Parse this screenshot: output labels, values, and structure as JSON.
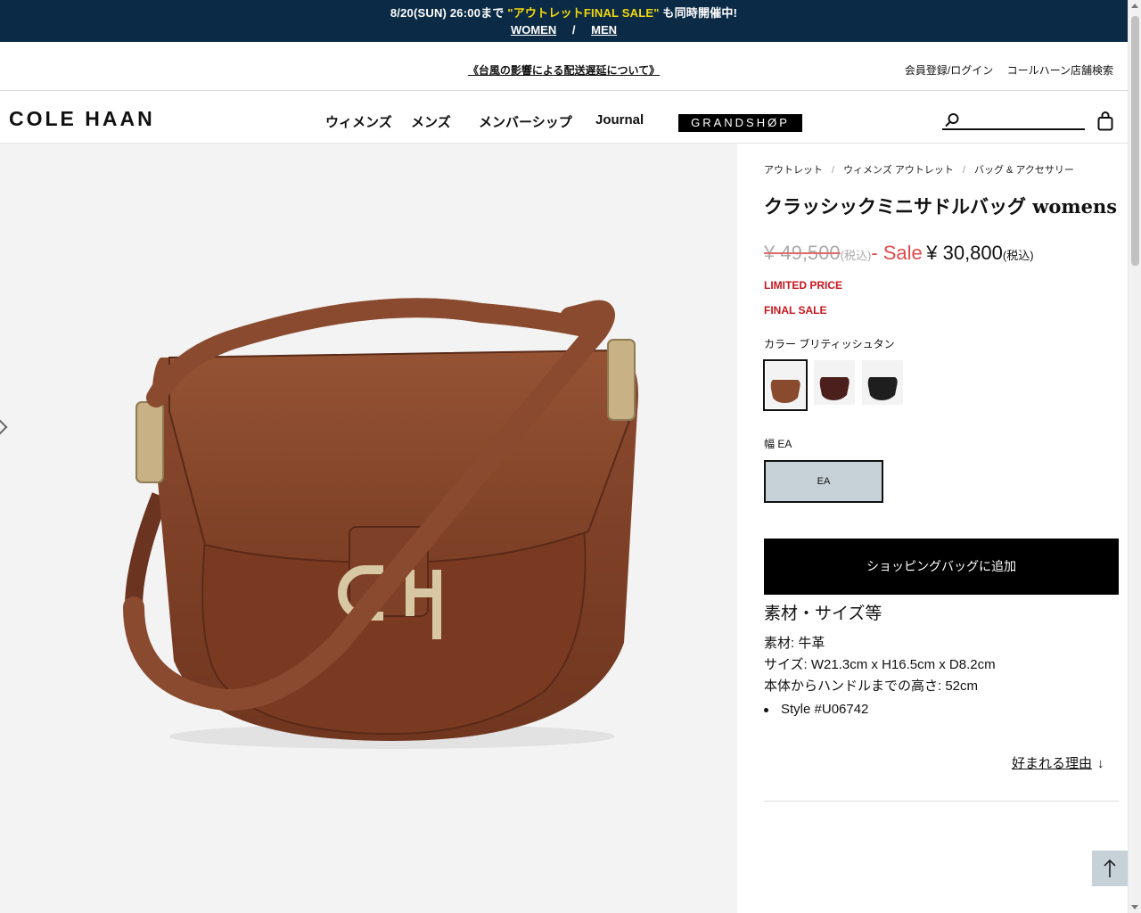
{
  "promo": {
    "text_prefix": "8/20(SUN) 26:00まで",
    "text_highlight": "\"アウトレットFINAL SALE\"",
    "text_suffix": "も同時開催中!",
    "link_women": "WOMEN",
    "separator": "/",
    "link_men": "MEN"
  },
  "util": {
    "notice": "《台風の影響による配送遅延について》",
    "login": "会員登録/ログイン",
    "store_search": "コールハーン店舗検索"
  },
  "header": {
    "logo": "COLE HAAN",
    "nav": {
      "women": "ウィメンズ",
      "men": "メンズ",
      "membership": "メンバーシップ",
      "journal": "Journal",
      "grandshop": "GRANDSHØP"
    },
    "search_placeholder": ""
  },
  "breadcrumb": [
    "アウトレット",
    "ウィメンズ アウトレット",
    "バッグ & アクセサリー"
  ],
  "breadcrumb_sep": "/",
  "product": {
    "title": "クラッシックミニサドルバッグ womens",
    "price_old": "¥ 49,500",
    "tax_old": "(税込)",
    "sale_label": "- Sale",
    "price_new": "¥ 30,800",
    "tax_new": "(税込)",
    "badge_limited": "LIMITED PRICE",
    "badge_final": "FINAL SALE",
    "color_label": "カラー ブリティッシュタン",
    "swatch_colors": [
      "#8a4a2e",
      "#4a1f1c",
      "#1e1e1e"
    ],
    "width_label": "幅 EA",
    "width_option": "EA",
    "add_to_bag": "ショッピングバッグに追加",
    "spec_title": "素材・サイズ等",
    "spec_material": "素材: 牛革",
    "spec_size": "サイズ: W21.3cm x H16.5cm x D8.2cm",
    "spec_height": "本体からハンドルまでの高さ: 52cm",
    "spec_style": "Style #U06742",
    "why_link": "好まれる理由",
    "why_arrow": "↓"
  },
  "colors": {
    "promo_bg": "#0b2a45",
    "promo_highlight": "#f5d90a",
    "sale_red": "#e04a4a",
    "badge_red": "#c8161d",
    "gallery_bg": "#f3f3f3",
    "width_selected_bg": "#c7d1d8"
  }
}
